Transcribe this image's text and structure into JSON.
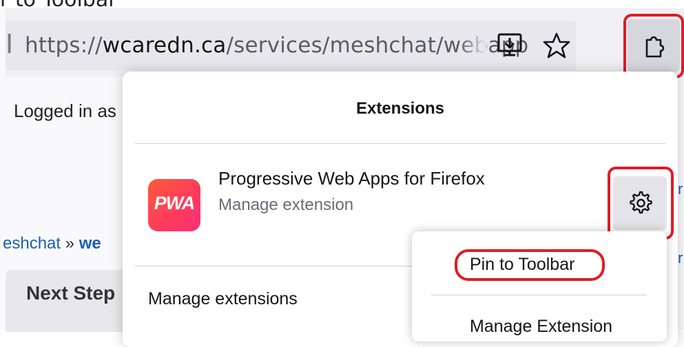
{
  "caption": "r to Toolbar",
  "browser": {
    "url_prefix": "https://",
    "url_domain": "wcaredn.ca",
    "url_path": "/services/meshchat/webapp",
    "url_edge_glyph": "I",
    "install_icon": "install-app-icon",
    "bookmark_icon": "star-icon",
    "extensions_icon": "puzzle-piece-icon"
  },
  "page": {
    "logged_in": "Logged in as",
    "breadcrumb_link": "eshchat",
    "breadcrumb_sep": " » ",
    "breadcrumb_current": "we",
    "next_step": "Next Step",
    "edge_letter": "r"
  },
  "extensions_panel": {
    "title": "Extensions",
    "extension": {
      "logo_text": "PWA",
      "name": "Progressive Web Apps for Firefox",
      "subtitle": "Manage extension"
    },
    "settings_icon": "gear-icon",
    "manage_link": "Manage extensions"
  },
  "context_menu": {
    "items": [
      {
        "label": "Pin to Toolbar"
      },
      {
        "label": "Manage Extension"
      }
    ]
  },
  "colors": {
    "highlight": "#e01b24",
    "pwa_gradient_start": "#ff5a3c",
    "pwa_gradient_end": "#ff2f7a",
    "link": "#1a5fb4"
  }
}
